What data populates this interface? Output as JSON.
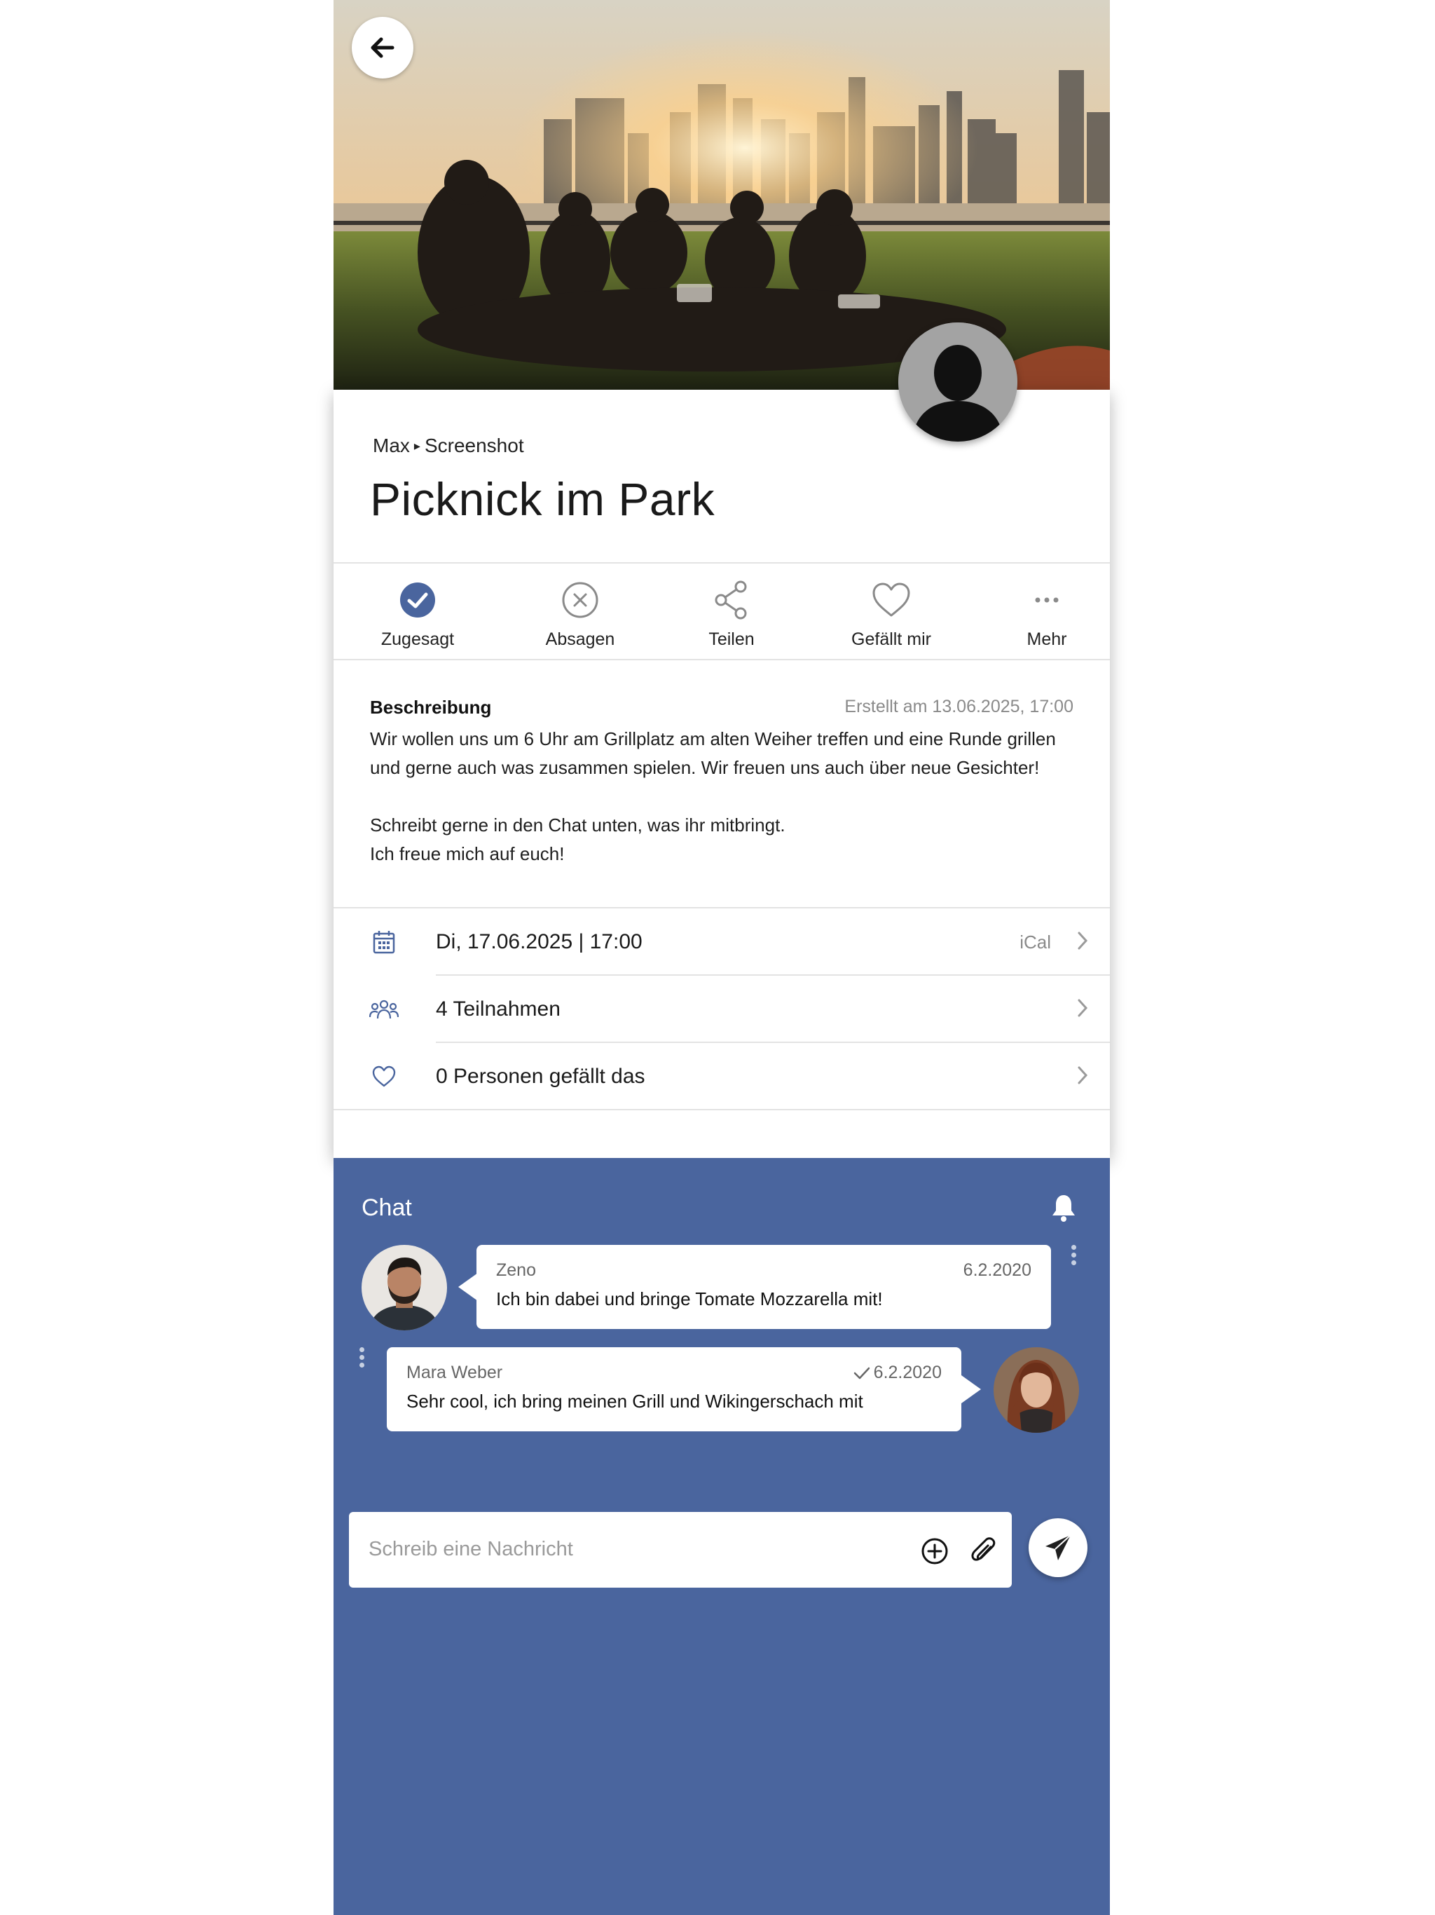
{
  "breadcrumb": {
    "author": "Max",
    "separator": "▸",
    "group": "Screenshot"
  },
  "event": {
    "title": "Picknick im Park"
  },
  "actions": [
    {
      "label": "Zugesagt",
      "icon": "check-circle-icon",
      "active": true
    },
    {
      "label": "Absagen",
      "icon": "x-circle-icon",
      "active": false
    },
    {
      "label": "Teilen",
      "icon": "share-icon",
      "active": false
    },
    {
      "label": "Gefällt mir",
      "icon": "heart-icon",
      "active": false
    },
    {
      "label": "Mehr",
      "icon": "more-icon",
      "active": false
    }
  ],
  "description": {
    "heading": "Beschreibung",
    "created": "Erstellt am 13.06.2025, 17:00",
    "line1": "Wir wollen uns um 6 Uhr am Grillplatz am alten Weiher treffen und eine Runde grillen",
    "line2": "und gerne auch was zusammen spielen. Wir freuen uns auch über neue Gesichter!",
    "line3": "Schreibt gerne in den Chat unten, was ihr mitbringt.",
    "line4": "Ich freue mich auf euch!"
  },
  "info": {
    "date": "Di, 17.06.2025 | 17:00",
    "ical": "iCal",
    "participants": "4 Teilnahmen",
    "likes": "0 Personen gefällt das"
  },
  "chat": {
    "title": "Chat",
    "messages": [
      {
        "name": "Zeno",
        "date": "6.2.2020",
        "text": "Ich bin dabei und bringe Tomate Mozzarella mit!",
        "own": false
      },
      {
        "name": "Mara Weber",
        "date": "6.2.2020",
        "text": "Sehr cool, ich bring meinen Grill und Wikingerschach mit",
        "own": true,
        "sent_check": true
      }
    ],
    "input_placeholder": "Schreib eine Nachricht"
  },
  "colors": {
    "accent": "#4a659e",
    "chat_background": "#4a659e",
    "icon_gray": "#8a8a8a"
  }
}
